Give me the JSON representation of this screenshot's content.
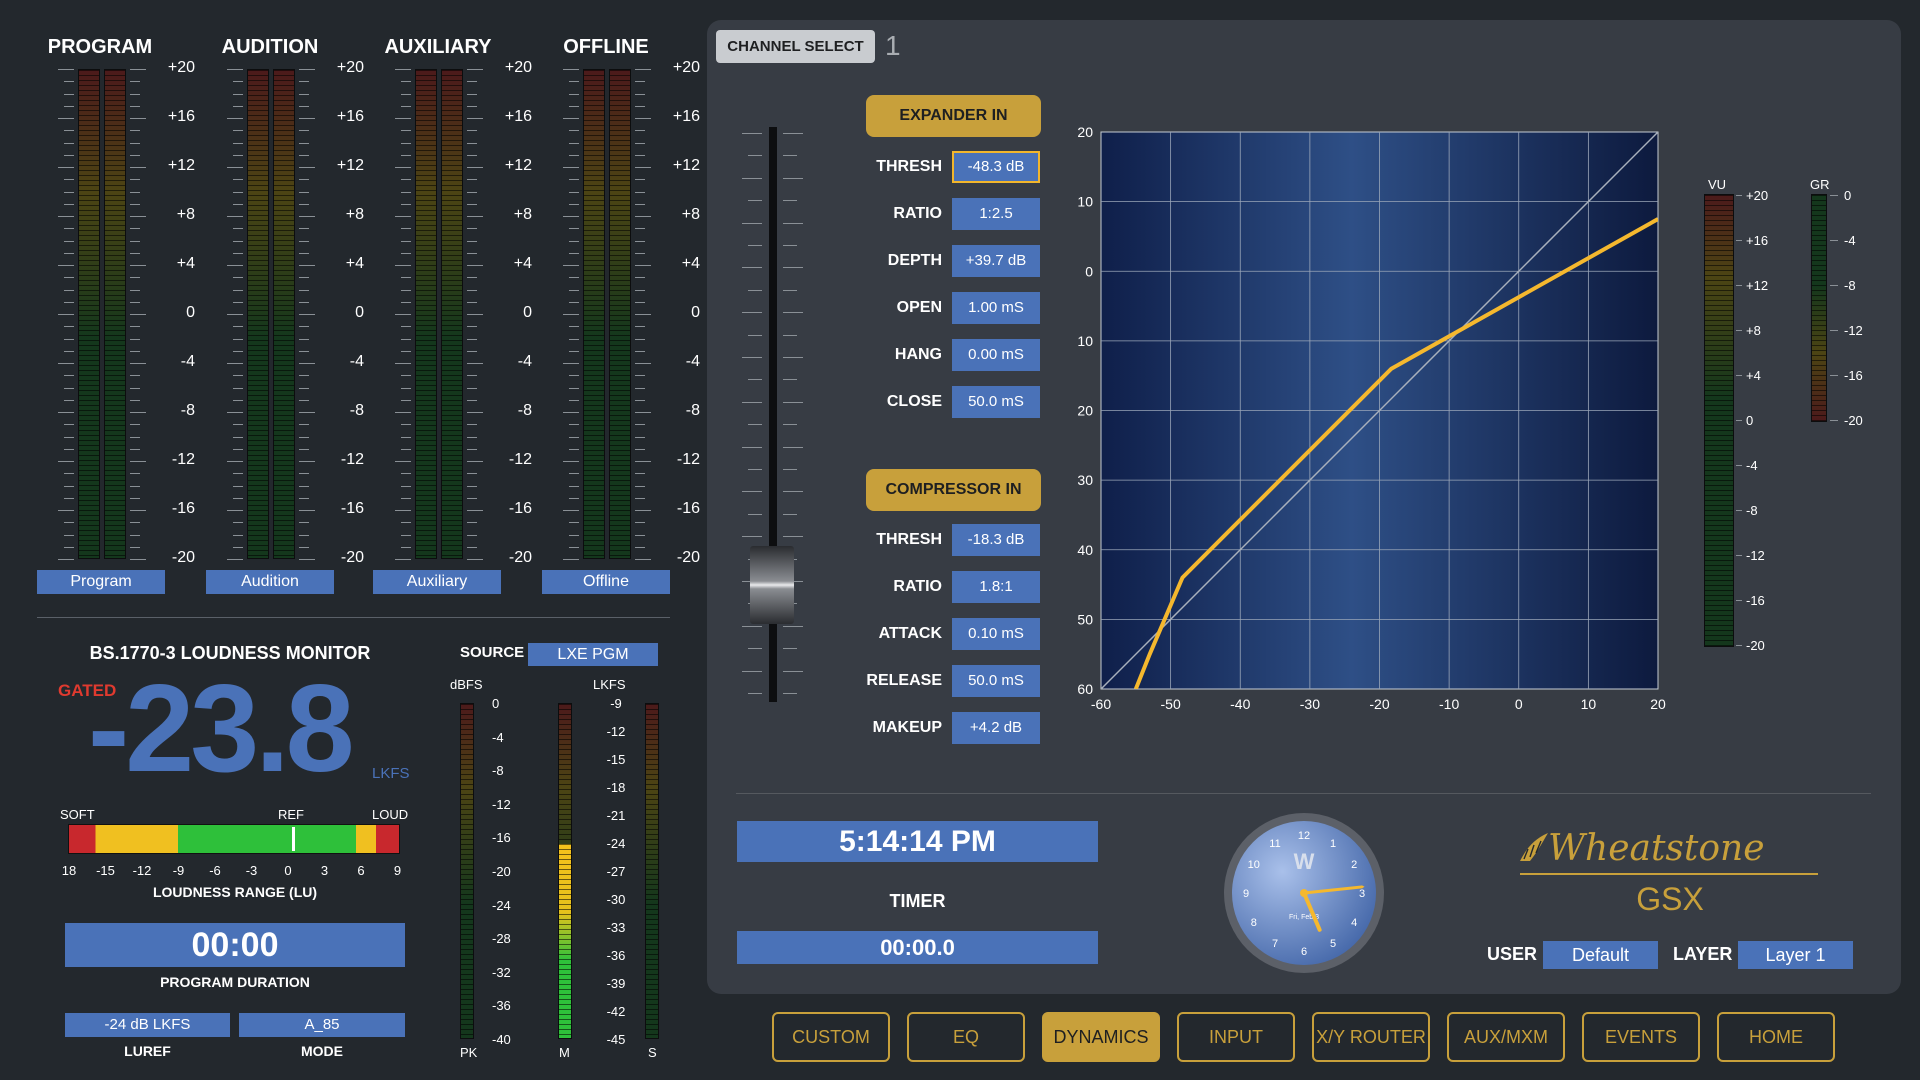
{
  "meters": [
    {
      "title": "PROGRAM",
      "button": "Program"
    },
    {
      "title": "AUDITION",
      "button": "Audition"
    },
    {
      "title": "AUXILIARY",
      "button": "Auxiliary"
    },
    {
      "title": "OFFLINE",
      "button": "Offline"
    }
  ],
  "meter_scale": [
    "+20",
    "+16",
    "+12",
    "+8",
    "+4",
    "0",
    "-4",
    "-8",
    "-12",
    "-16",
    "-20"
  ],
  "loudness": {
    "title": "BS.1770-3 LOUDNESS MONITOR",
    "gated": "GATED",
    "value": "-23.8",
    "unit": "LKFS",
    "source_label": "SOURCE",
    "source_value": "LXE PGM",
    "range_soft": "SOFT",
    "range_ref": "REF",
    "range_loud": "LOUD",
    "range_ticks": [
      "18",
      "-15",
      "-12",
      "-9",
      "-6",
      "-3",
      "0",
      "3",
      "6",
      "9"
    ],
    "range_label": "LOUDNESS RANGE (LU)",
    "duration": "00:00",
    "duration_label": "PROGRAM DURATION",
    "luref_value": "-24 dB LKFS",
    "luref_label": "LUREF",
    "mode_value": "A_85",
    "mode_label": "MODE",
    "dbfs_label": "dBFS",
    "dbfs_scale": [
      "0",
      "-4",
      "-8",
      "-12",
      "-16",
      "-20",
      "-24",
      "-28",
      "-32",
      "-36",
      "-40"
    ],
    "lkfs_label": "LKFS",
    "lkfs_scale": [
      "-9",
      "-12",
      "-15",
      "-18",
      "-21",
      "-24",
      "-27",
      "-30",
      "-33",
      "-36",
      "-39",
      "-42",
      "-45"
    ],
    "pk_label": "PK",
    "m_label": "M",
    "s_label": "S",
    "m_level_fraction": 0.58
  },
  "channel": {
    "select_label": "CHANNEL SELECT",
    "number": "1"
  },
  "expander": {
    "button": "EXPANDER IN",
    "params": [
      {
        "label": "THRESH",
        "value": "-48.3 dB"
      },
      {
        "label": "RATIO",
        "value": "1:2.5"
      },
      {
        "label": "DEPTH",
        "value": "+39.7 dB"
      },
      {
        "label": "OPEN",
        "value": "1.00 mS"
      },
      {
        "label": "HANG",
        "value": "0.00 mS"
      },
      {
        "label": "CLOSE",
        "value": "50.0 mS"
      }
    ]
  },
  "compressor": {
    "button": "COMPRESSOR IN",
    "params": [
      {
        "label": "THRESH",
        "value": "-18.3 dB"
      },
      {
        "label": "RATIO",
        "value": "1.8:1"
      },
      {
        "label": "ATTACK",
        "value": "0.10 mS"
      },
      {
        "label": "RELEASE",
        "value": "50.0 mS"
      },
      {
        "label": "MAKEUP",
        "value": "+4.2 dB"
      }
    ]
  },
  "chart_data": {
    "type": "line",
    "title": "",
    "xlabel": "",
    "ylabel": "",
    "x_ticks": [
      "-60",
      "-50",
      "-40",
      "-30",
      "-20",
      "-10",
      "0",
      "10",
      "20"
    ],
    "y_ticks": [
      "20",
      "10",
      "0",
      "10",
      "20",
      "30",
      "40",
      "50",
      "60"
    ],
    "xlim": [
      -60,
      20
    ],
    "ylim": [
      -60,
      20
    ],
    "grid": true,
    "series": [
      {
        "values_x": [
          -60,
          20
        ],
        "values_y": [
          -60,
          20
        ],
        "color": "#a8b0bc"
      },
      {
        "values_x": [
          -55,
          -53,
          -48.3,
          -18.3,
          20
        ],
        "values_y": [
          -60,
          -55,
          -44,
          -14,
          7.5
        ],
        "color": "#f5b82e"
      }
    ]
  },
  "vu": {
    "label": "VU",
    "scale": [
      "+20",
      "+16",
      "+12",
      "+8",
      "+4",
      "0",
      "-4",
      "-8",
      "-12",
      "-16",
      "-20"
    ]
  },
  "gr": {
    "label": "GR",
    "scale": [
      "0",
      "-4",
      "-8",
      "-12",
      "-16",
      "-20"
    ]
  },
  "clock": {
    "time": "5:14:14 PM",
    "timer_label": "TIMER",
    "timer": "00:00.0",
    "date": "Fri, Feb 3",
    "numbers": [
      "12",
      "1",
      "2",
      "3",
      "4",
      "5",
      "6",
      "7",
      "8",
      "9",
      "10",
      "11"
    ],
    "logo_letter": "W"
  },
  "brand": {
    "name": "Wheatstone",
    "product": "GSX",
    "user_label": "USER",
    "user_value": "Default",
    "layer_label": "LAYER",
    "layer_value": "Layer 1"
  },
  "nav": [
    "CUSTOM",
    "EQ",
    "DYNAMICS",
    "INPUT",
    "X/Y ROUTER",
    "AUX/MXM",
    "EVENTS",
    "HOME"
  ],
  "nav_active": "DYNAMICS"
}
